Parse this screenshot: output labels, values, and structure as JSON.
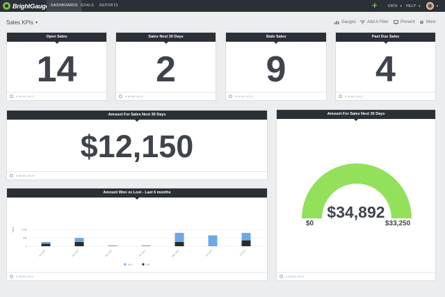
{
  "app": {
    "logo": "BrightGauge",
    "nav": [
      "DASHBOARDS",
      "GOALS",
      "REPORTS"
    ],
    "right_menu": [
      "DATA",
      "HELP"
    ]
  },
  "dashboard": {
    "title": "Sales KPIs",
    "toolbar": [
      "Gauges",
      "Add A Filter",
      "Present",
      "More"
    ]
  },
  "widgets": {
    "open_sales": {
      "title": "Open Sales",
      "value": "14",
      "updated": "6 MINS AGO"
    },
    "sales_next_30": {
      "title": "Sales Next 30 Days",
      "value": "2",
      "updated": "6 MINS AGO"
    },
    "stale_sales": {
      "title": "Stale Sales",
      "value": "9",
      "updated": "6 MINS AGO"
    },
    "past_due_sales": {
      "title": "Past Due Sales",
      "value": "4",
      "updated": "6 MINS AGO"
    },
    "amount_next_30": {
      "title": "Amount For Sales Next 30 Days",
      "value": "$12,150",
      "updated": "6 MINS AGO"
    },
    "gauge": {
      "title": "Amount For Sales Next 30 Days",
      "value": "$34,892",
      "min": "$0",
      "max": "$33,250",
      "updated": "6 MINS AGO"
    },
    "won_lost": {
      "title": "Amount Won vs Lost - Last 6 months",
      "updated": "6 MINS AGO"
    }
  },
  "colors": {
    "nav_bg": "#2b2f36",
    "won": "#6aa9e3",
    "lost": "#2b2b2b",
    "gauge": "#93e05a",
    "accent": "#7ac143"
  },
  "chart_data": {
    "type": "bar",
    "stacked": true,
    "ylabel": "Value",
    "ylim": [
      0,
      200000
    ],
    "yticks": [
      "100K",
      "50K",
      "0"
    ],
    "categories": [
      "Jan 2017",
      "Feb 2017",
      "Mar 2017",
      "Apr 2017",
      "May 2017",
      "Jun 2017",
      "Jul 2017"
    ],
    "series": [
      {
        "name": "won",
        "values": [
          10000,
          25000,
          5000,
          5000,
          55000,
          65000,
          45000
        ]
      },
      {
        "name": "lost",
        "values": [
          15000,
          25000,
          0,
          0,
          25000,
          0,
          35000
        ]
      }
    ],
    "legend": "bottom",
    "grid": true
  }
}
